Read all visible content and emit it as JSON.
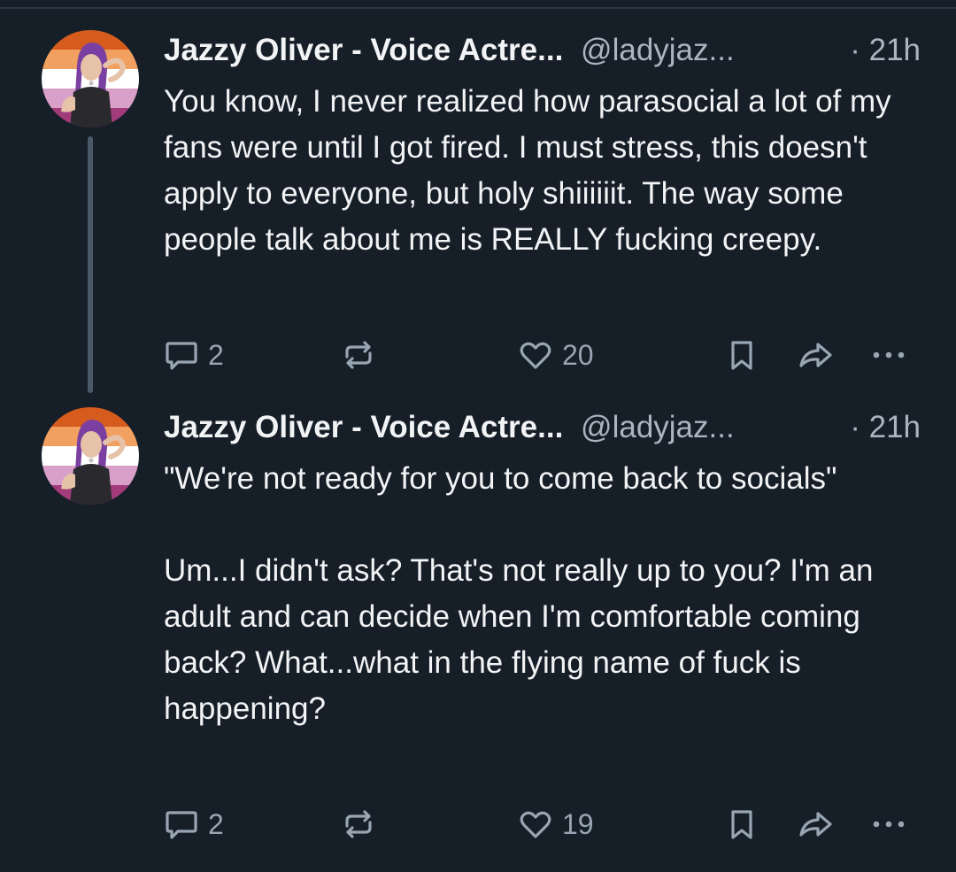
{
  "posts": [
    {
      "author": {
        "display_name": "Jazzy Oliver - Voice Actre...",
        "handle": "@ladyjaz...",
        "avatar_icon": "avatar-illustration-icon"
      },
      "timestamp": "· 21h",
      "paragraphs": [
        "You know, I never realized how parasocial a lot of my fans were until I got fired. I must stress, this doesn't apply to everyone, but holy shiiiiiit. The way some people talk about me is REALLY fucking creepy."
      ],
      "actions": {
        "reply_count": "2",
        "repost_count": "",
        "like_count": "20"
      },
      "thread_continues": true
    },
    {
      "author": {
        "display_name": "Jazzy Oliver - Voice Actre...",
        "handle": "@ladyjaz...",
        "avatar_icon": "avatar-illustration-icon"
      },
      "timestamp": "· 21h",
      "paragraphs": [
        "\"We're not ready for you to come back to socials\"",
        "Um...I didn't ask? That's not really up to you? I'm an adult and can decide when I'm comfortable coming back? What...what in the flying name of fuck is happening?"
      ],
      "actions": {
        "reply_count": "2",
        "repost_count": "",
        "like_count": "19"
      },
      "thread_continues": false
    }
  ],
  "icons": {
    "reply": "speech-bubble-icon",
    "repost": "repost-arrows-icon",
    "like": "heart-icon",
    "bookmark": "bookmark-icon",
    "share": "share-arrow-icon",
    "more": "ellipsis-icon"
  },
  "colors": {
    "background": "#161e27",
    "text_primary": "#f1f3f5",
    "text_secondary": "#aab5c0",
    "icon": "#98a5b3",
    "thread_line": "#4a5968",
    "avatar_flag_orange": "#d65c1e",
    "avatar_flag_pink": "#e89bbd"
  }
}
